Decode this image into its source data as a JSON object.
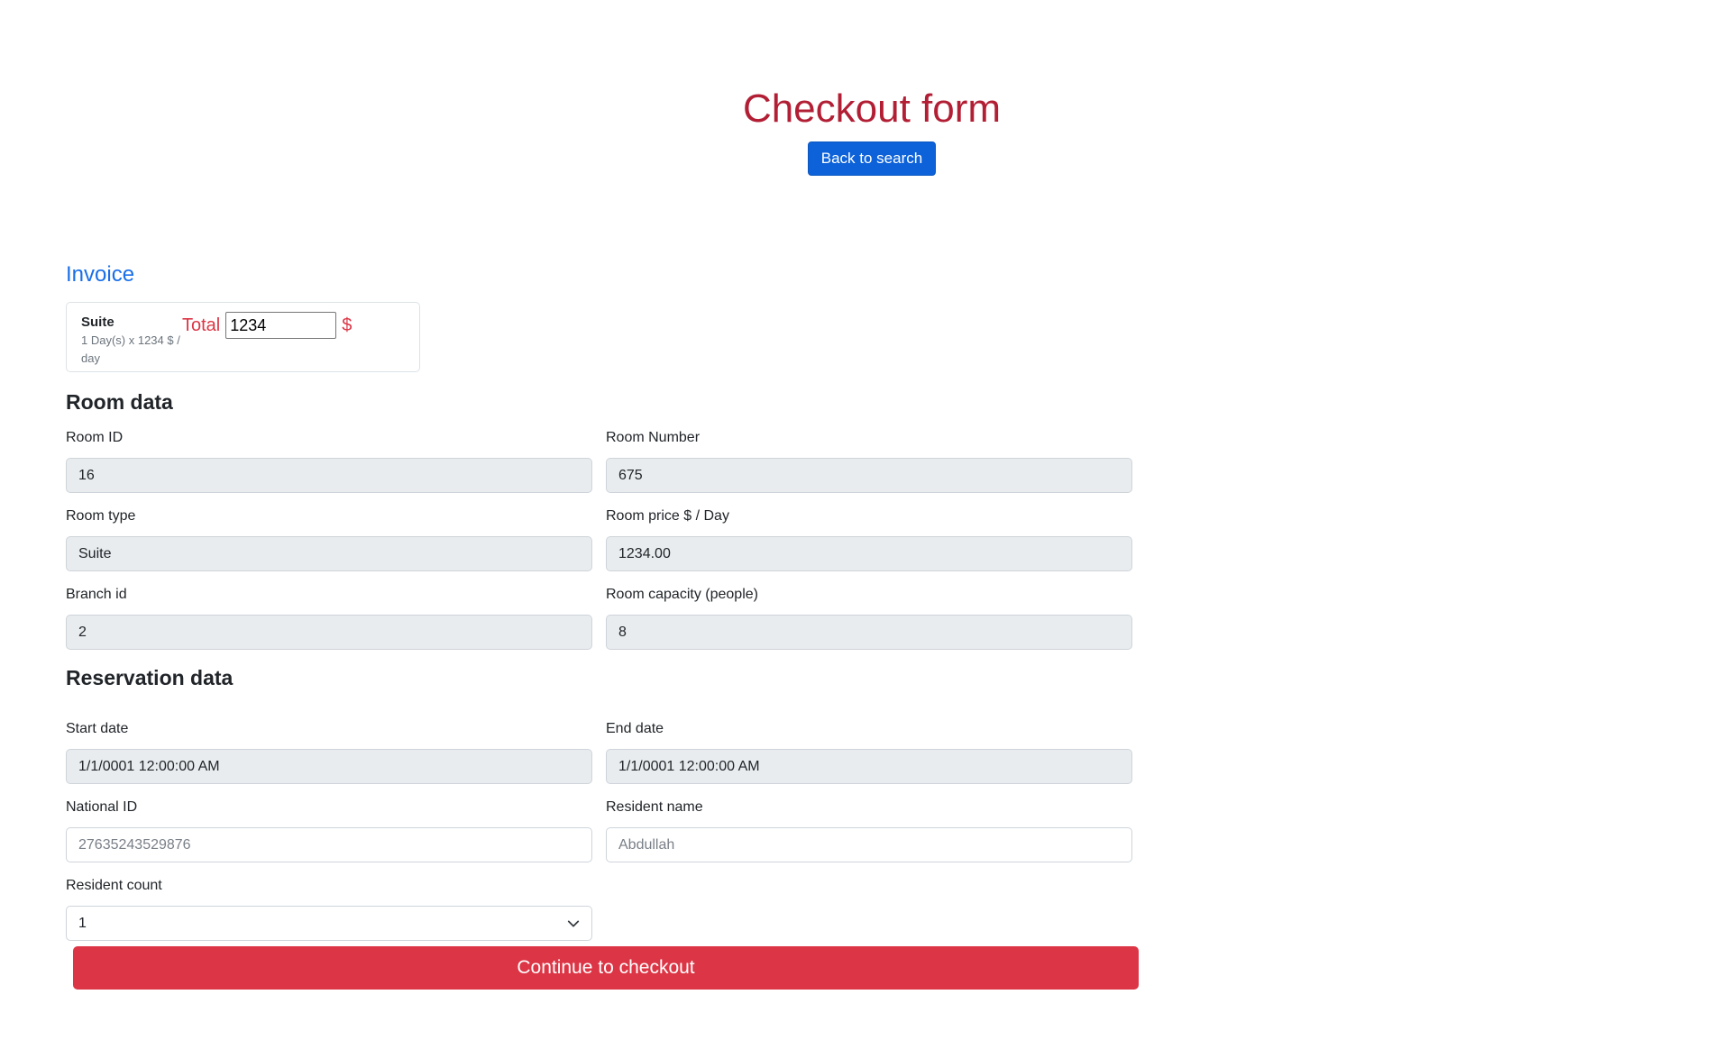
{
  "header": {
    "title": "Checkout form",
    "back_label": "Back to search"
  },
  "invoice": {
    "title": "Invoice",
    "item_name": "Suite",
    "item_desc": "1 Day(s) x 1234 $ / day",
    "total_label": "Total",
    "total_value": "1234",
    "currency": "$"
  },
  "room": {
    "heading": "Room data",
    "fields": {
      "room_id": {
        "label": "Room ID",
        "value": "16"
      },
      "room_number": {
        "label": "Room Number",
        "value": "675"
      },
      "room_type": {
        "label": "Room type",
        "value": "Suite"
      },
      "room_price": {
        "label": "Room price $ / Day",
        "value": "1234.00"
      },
      "branch_id": {
        "label": "Branch id",
        "value": "2"
      },
      "capacity": {
        "label": "Room capacity (people)",
        "value": "8"
      }
    }
  },
  "reservation": {
    "heading": "Reservation data",
    "fields": {
      "start_date": {
        "label": "Start date",
        "value": "1/1/0001 12:00:00 AM"
      },
      "end_date": {
        "label": "End date",
        "value": "1/1/0001 12:00:00 AM"
      },
      "national_id": {
        "label": "National ID",
        "placeholder": "27635243529876"
      },
      "resident_name": {
        "label": "Resident name",
        "placeholder": "Abdullah"
      },
      "resident_count": {
        "label": "Resident count",
        "value": "1"
      }
    }
  },
  "checkout": {
    "label": "Continue to checkout"
  },
  "colors": {
    "title": "#b21f35",
    "primary": "#0d62d9",
    "danger": "#dc3545",
    "invoice_title": "#1a6fe8",
    "disabled_bg": "#e9ecef"
  }
}
